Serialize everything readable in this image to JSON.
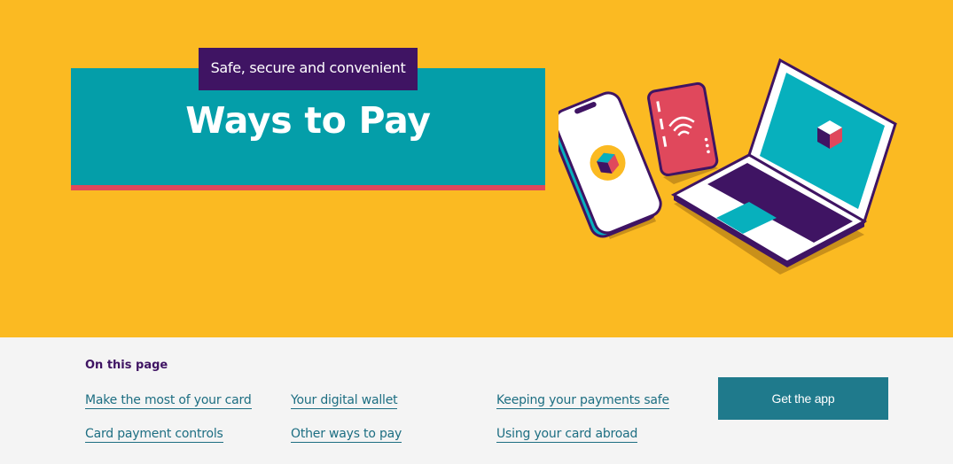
{
  "hero": {
    "tagline": "Safe, secure and convenient",
    "title": "Ways to Pay",
    "colors": {
      "background": "#fbba22",
      "title_box": "#049ea9",
      "title_shadow": "#e0485c",
      "tagline_bg": "#3f1463"
    },
    "illustration_icons": [
      "smartphone-icon",
      "contactless-card-icon",
      "laptop-icon"
    ]
  },
  "toc": {
    "heading": "On this page",
    "links": [
      {
        "label": "Make the most of your card"
      },
      {
        "label": "Card payment controls"
      },
      {
        "label": "Your digital wallet"
      },
      {
        "label": "Other ways to pay"
      },
      {
        "label": "Keeping your payments safe"
      },
      {
        "label": "Using your card abroad"
      }
    ],
    "cta_label": "Get the app",
    "colors": {
      "background": "#f4f4f4",
      "link": "#1d6e82",
      "cta": "#1f7a8c"
    }
  }
}
